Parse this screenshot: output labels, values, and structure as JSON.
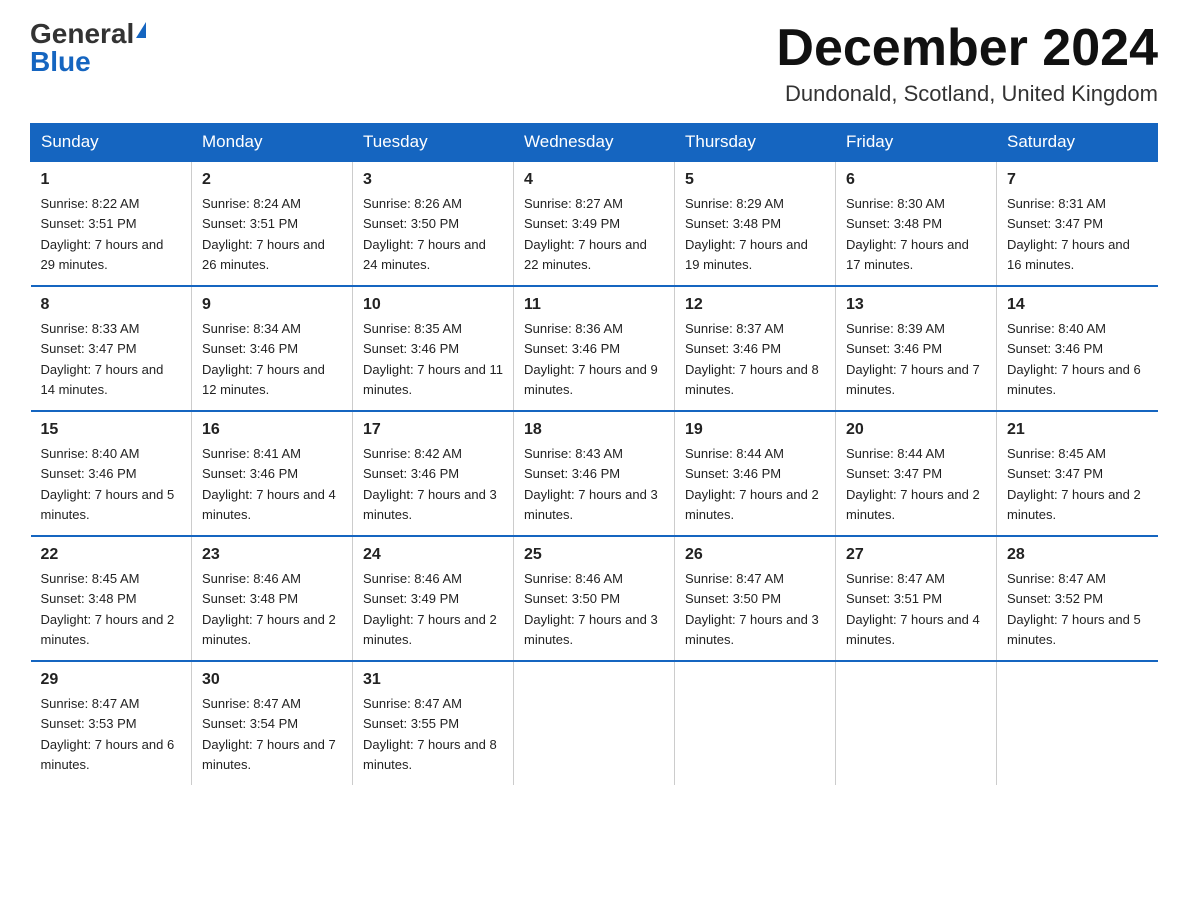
{
  "header": {
    "logo_general": "General",
    "logo_blue": "Blue",
    "month_title": "December 2024",
    "location": "Dundonald, Scotland, United Kingdom"
  },
  "days_of_week": [
    "Sunday",
    "Monday",
    "Tuesday",
    "Wednesday",
    "Thursday",
    "Friday",
    "Saturday"
  ],
  "weeks": [
    [
      {
        "day": "1",
        "sunrise": "8:22 AM",
        "sunset": "3:51 PM",
        "daylight": "7 hours and 29 minutes."
      },
      {
        "day": "2",
        "sunrise": "8:24 AM",
        "sunset": "3:51 PM",
        "daylight": "7 hours and 26 minutes."
      },
      {
        "day": "3",
        "sunrise": "8:26 AM",
        "sunset": "3:50 PM",
        "daylight": "7 hours and 24 minutes."
      },
      {
        "day": "4",
        "sunrise": "8:27 AM",
        "sunset": "3:49 PM",
        "daylight": "7 hours and 22 minutes."
      },
      {
        "day": "5",
        "sunrise": "8:29 AM",
        "sunset": "3:48 PM",
        "daylight": "7 hours and 19 minutes."
      },
      {
        "day": "6",
        "sunrise": "8:30 AM",
        "sunset": "3:48 PM",
        "daylight": "7 hours and 17 minutes."
      },
      {
        "day": "7",
        "sunrise": "8:31 AM",
        "sunset": "3:47 PM",
        "daylight": "7 hours and 16 minutes."
      }
    ],
    [
      {
        "day": "8",
        "sunrise": "8:33 AM",
        "sunset": "3:47 PM",
        "daylight": "7 hours and 14 minutes."
      },
      {
        "day": "9",
        "sunrise": "8:34 AM",
        "sunset": "3:46 PM",
        "daylight": "7 hours and 12 minutes."
      },
      {
        "day": "10",
        "sunrise": "8:35 AM",
        "sunset": "3:46 PM",
        "daylight": "7 hours and 11 minutes."
      },
      {
        "day": "11",
        "sunrise": "8:36 AM",
        "sunset": "3:46 PM",
        "daylight": "7 hours and 9 minutes."
      },
      {
        "day": "12",
        "sunrise": "8:37 AM",
        "sunset": "3:46 PM",
        "daylight": "7 hours and 8 minutes."
      },
      {
        "day": "13",
        "sunrise": "8:39 AM",
        "sunset": "3:46 PM",
        "daylight": "7 hours and 7 minutes."
      },
      {
        "day": "14",
        "sunrise": "8:40 AM",
        "sunset": "3:46 PM",
        "daylight": "7 hours and 6 minutes."
      }
    ],
    [
      {
        "day": "15",
        "sunrise": "8:40 AM",
        "sunset": "3:46 PM",
        "daylight": "7 hours and 5 minutes."
      },
      {
        "day": "16",
        "sunrise": "8:41 AM",
        "sunset": "3:46 PM",
        "daylight": "7 hours and 4 minutes."
      },
      {
        "day": "17",
        "sunrise": "8:42 AM",
        "sunset": "3:46 PM",
        "daylight": "7 hours and 3 minutes."
      },
      {
        "day": "18",
        "sunrise": "8:43 AM",
        "sunset": "3:46 PM",
        "daylight": "7 hours and 3 minutes."
      },
      {
        "day": "19",
        "sunrise": "8:44 AM",
        "sunset": "3:46 PM",
        "daylight": "7 hours and 2 minutes."
      },
      {
        "day": "20",
        "sunrise": "8:44 AM",
        "sunset": "3:47 PM",
        "daylight": "7 hours and 2 minutes."
      },
      {
        "day": "21",
        "sunrise": "8:45 AM",
        "sunset": "3:47 PM",
        "daylight": "7 hours and 2 minutes."
      }
    ],
    [
      {
        "day": "22",
        "sunrise": "8:45 AM",
        "sunset": "3:48 PM",
        "daylight": "7 hours and 2 minutes."
      },
      {
        "day": "23",
        "sunrise": "8:46 AM",
        "sunset": "3:48 PM",
        "daylight": "7 hours and 2 minutes."
      },
      {
        "day": "24",
        "sunrise": "8:46 AM",
        "sunset": "3:49 PM",
        "daylight": "7 hours and 2 minutes."
      },
      {
        "day": "25",
        "sunrise": "8:46 AM",
        "sunset": "3:50 PM",
        "daylight": "7 hours and 3 minutes."
      },
      {
        "day": "26",
        "sunrise": "8:47 AM",
        "sunset": "3:50 PM",
        "daylight": "7 hours and 3 minutes."
      },
      {
        "day": "27",
        "sunrise": "8:47 AM",
        "sunset": "3:51 PM",
        "daylight": "7 hours and 4 minutes."
      },
      {
        "day": "28",
        "sunrise": "8:47 AM",
        "sunset": "3:52 PM",
        "daylight": "7 hours and 5 minutes."
      }
    ],
    [
      {
        "day": "29",
        "sunrise": "8:47 AM",
        "sunset": "3:53 PM",
        "daylight": "7 hours and 6 minutes."
      },
      {
        "day": "30",
        "sunrise": "8:47 AM",
        "sunset": "3:54 PM",
        "daylight": "7 hours and 7 minutes."
      },
      {
        "day": "31",
        "sunrise": "8:47 AM",
        "sunset": "3:55 PM",
        "daylight": "7 hours and 8 minutes."
      },
      null,
      null,
      null,
      null
    ]
  ]
}
